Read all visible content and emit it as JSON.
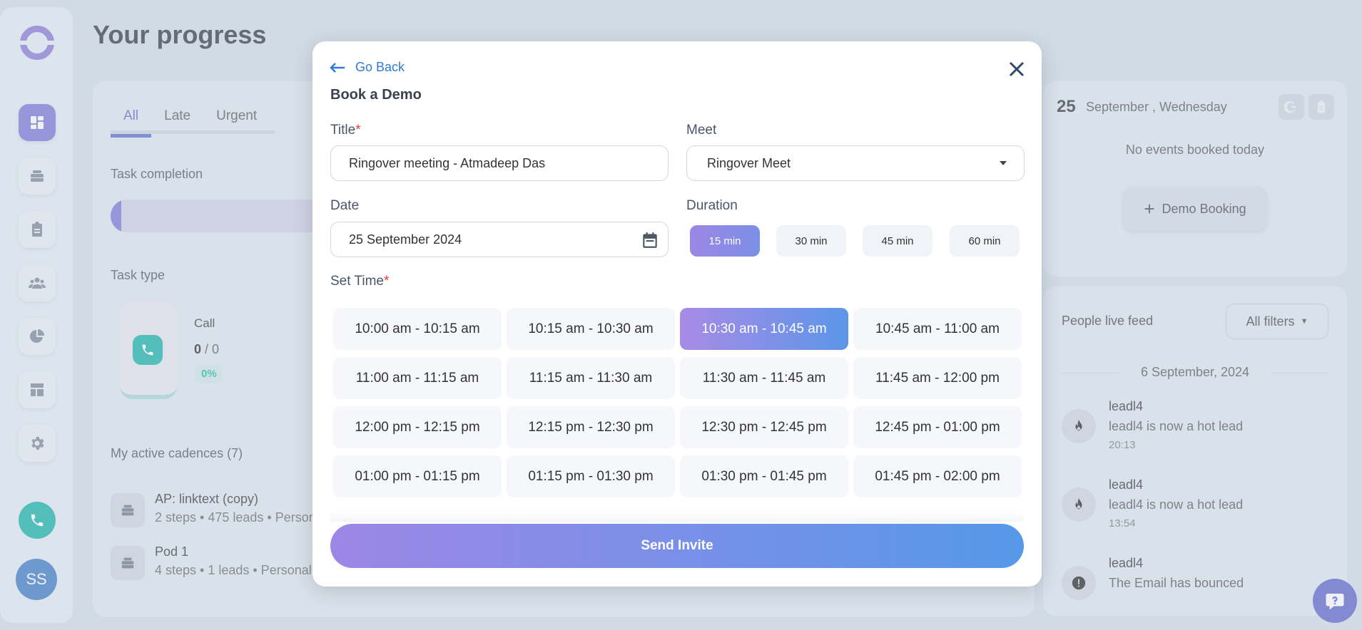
{
  "app": {
    "page_title": "Your progress",
    "avatar_initials": "SS"
  },
  "sidebar": {
    "items": [
      {
        "icon": "dashboard-icon",
        "active": true
      },
      {
        "icon": "cadences-icon"
      },
      {
        "icon": "tasks-icon"
      },
      {
        "icon": "people-icon"
      },
      {
        "icon": "analytics-icon"
      },
      {
        "icon": "templates-icon"
      },
      {
        "icon": "settings-icon"
      }
    ]
  },
  "progress": {
    "tabs": [
      "All",
      "Late",
      "Urgent"
    ],
    "task_completion_label": "Task completion",
    "task_completion_fraction": 0.05,
    "task_type_label": "Task type",
    "call_label": "Call",
    "call_done": "0",
    "call_total": "/ 0",
    "call_percent": "0%",
    "cadences_title": "My active cadences (7)",
    "cadences": [
      {
        "name": "AP: linktext (copy)",
        "meta": "2 steps • 475 leads • Person"
      },
      {
        "name": "Pod 1",
        "meta": "4 steps • 1 leads • Personal"
      }
    ]
  },
  "calendar": {
    "day": "25",
    "date_text": "September , Wednesday",
    "no_events": "No events booked today",
    "demo_booking": "Demo Booking"
  },
  "feed": {
    "title": "People live feed",
    "filters_label": "All filters",
    "date": "6 September, 2024",
    "items": [
      {
        "name": "leadl4",
        "message": "leadl4 is now a hot lead",
        "time": "20:13",
        "icon": "flame-icon"
      },
      {
        "name": "leadl4",
        "message": "leadl4 is now a hot lead",
        "time": "13:54",
        "icon": "flame-icon"
      },
      {
        "name": "leadl4",
        "message": "The Email has bounced",
        "time": "",
        "icon": "alert-icon"
      }
    ]
  },
  "modal": {
    "go_back": "Go Back",
    "title": "Book a Demo",
    "title_label": "Title",
    "title_value": "Ringover meeting - Atmadeep Das",
    "meet_label": "Meet",
    "meet_value": "Ringover Meet",
    "date_label": "Date",
    "date_value": "25 September 2024",
    "duration_label": "Duration",
    "durations": [
      "15 min",
      "30 min",
      "45 min",
      "60 min"
    ],
    "selected_duration": "15 min",
    "set_time_label": "Set Time",
    "required_marker": "*",
    "time_slots": [
      "10:00 am - 10:15 am",
      "10:15 am - 10:30 am",
      "10:30 am - 10:45 am",
      "10:45 am - 11:00 am",
      "11:00 am - 11:15 am",
      "11:15 am - 11:30 am",
      "11:30 am - 11:45 am",
      "11:45 am - 12:00 pm",
      "12:00 pm - 12:15 pm",
      "12:15 pm - 12:30 pm",
      "12:30 pm - 12:45 pm",
      "12:45 pm - 01:00 pm",
      "01:00 pm - 01:15 pm",
      "01:15 pm - 01:30 pm",
      "01:30 pm - 01:45 pm",
      "01:45 pm - 02:00 pm"
    ],
    "selected_slot": "10:30 am - 10:45 am",
    "send_invite": "Send Invite"
  },
  "colors": {
    "accent": "#7b74d6",
    "link": "#2f7bd8",
    "call_green": "#13b1a6",
    "required": "#e53c3c"
  }
}
